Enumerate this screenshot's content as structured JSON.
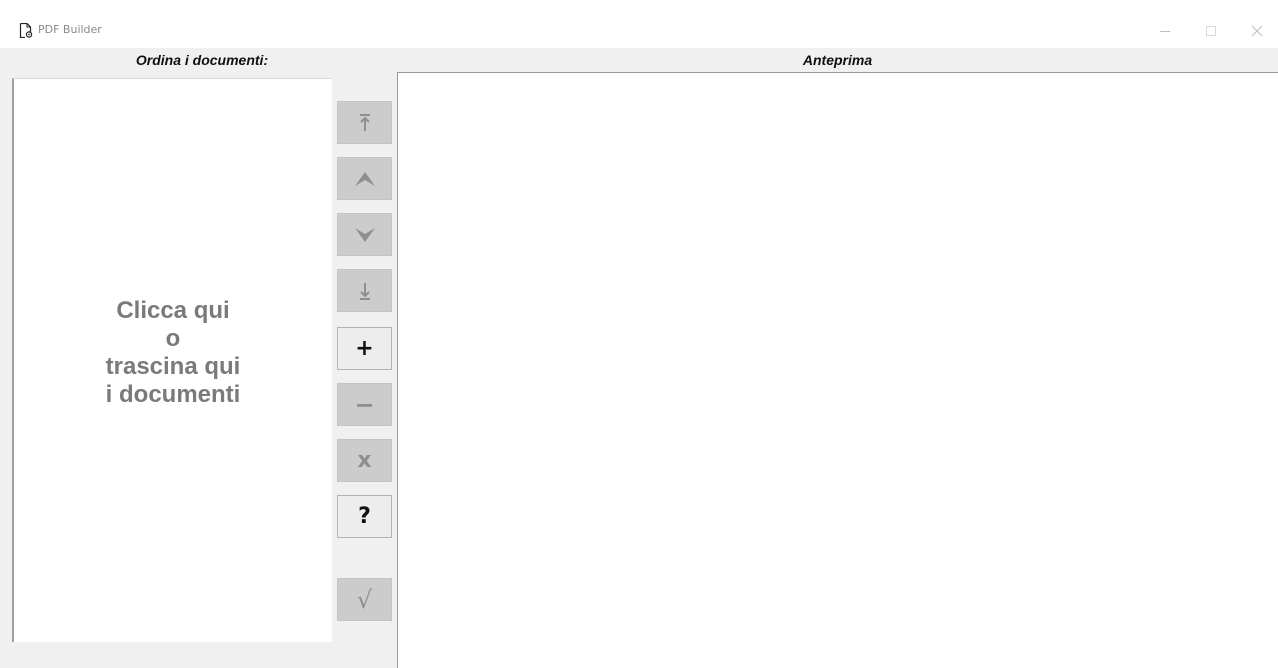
{
  "window": {
    "title": "PDF Builder",
    "controls": {
      "minimize": "minimize-icon",
      "maximize": "maximize-icon",
      "close": "close-icon"
    }
  },
  "left_panel": {
    "header": "Ordina i documenti:",
    "drop_lines": [
      "Clicca qui",
      "o",
      "trascina qui",
      "i documenti"
    ]
  },
  "right_panel": {
    "header": "Anteprima"
  },
  "side_buttons": [
    {
      "id": "move-top",
      "glyph": "⤒",
      "enabled": false
    },
    {
      "id": "move-up",
      "glyph": "⮝",
      "enabled": false
    },
    {
      "id": "move-down",
      "glyph": "⮟",
      "enabled": false
    },
    {
      "id": "move-bottom",
      "glyph": "⤓",
      "enabled": false
    },
    {
      "id": "add",
      "glyph": "+",
      "enabled": true
    },
    {
      "id": "remove",
      "glyph": "−",
      "enabled": false
    },
    {
      "id": "clear",
      "glyph": "x",
      "enabled": false
    },
    {
      "id": "help",
      "glyph": "?",
      "enabled": true
    },
    {
      "id": "confirm",
      "glyph": "√",
      "enabled": false
    }
  ],
  "colors": {
    "window_bg": "#f0f0f0",
    "panel_bg": "#ffffff",
    "button_disabled_bg": "#cccccc",
    "button_disabled_fg": "#8f8f8f",
    "button_enabled_bg": "#ededed",
    "button_enabled_fg": "#111111",
    "drop_text": "#7a7a7a"
  }
}
